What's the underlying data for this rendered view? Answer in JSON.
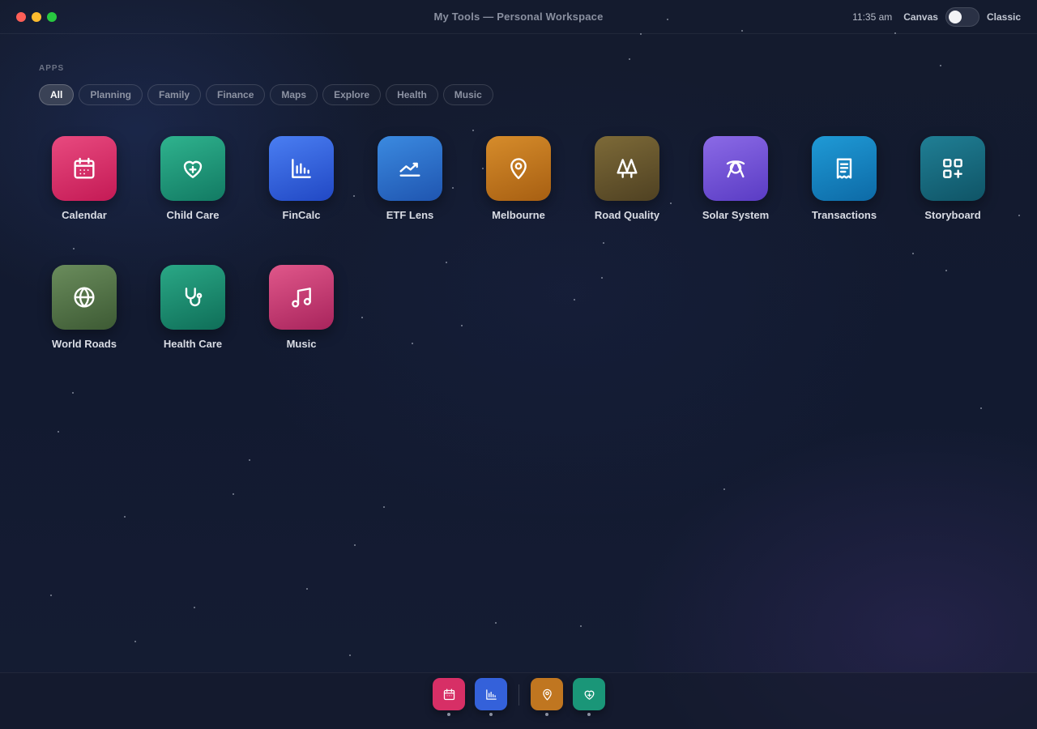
{
  "window": {
    "title": "My Tools — Personal Workspace"
  },
  "status": {
    "time": "11:35 am",
    "mode_left": "Canvas",
    "mode_right": "Classic"
  },
  "section": {
    "label": "APPS"
  },
  "filters": [
    "All",
    "Planning",
    "Family",
    "Finance",
    "Maps",
    "Explore",
    "Health",
    "Music"
  ],
  "active_filter": "All",
  "apps": [
    {
      "label": "Calendar",
      "icon": "calendar-icon",
      "color_top": "#e84a7f",
      "color_bottom": "#c41a55"
    },
    {
      "label": "Child Care",
      "icon": "heart-plus-icon",
      "color_top": "#2fb38e",
      "color_bottom": "#127a63"
    },
    {
      "label": "FinCalc",
      "icon": "bar-chart-icon",
      "color_top": "#4a7ef2",
      "color_bottom": "#2148c4"
    },
    {
      "label": "ETF Lens",
      "icon": "trend-line-icon",
      "color_top": "#3b8ae0",
      "color_bottom": "#1f55b0"
    },
    {
      "label": "Melbourne",
      "icon": "map-pin-icon",
      "color_top": "#d68c2b",
      "color_bottom": "#a75f12"
    },
    {
      "label": "Road Quality",
      "icon": "trees-icon",
      "color_top": "#7d6a38",
      "color_bottom": "#4f4122"
    },
    {
      "label": "Solar System",
      "icon": "orbit-icon",
      "color_top": "#8b6ae6",
      "color_bottom": "#5a3cc4"
    },
    {
      "label": "Transactions",
      "icon": "receipt-icon",
      "color_top": "#1f9ad6",
      "color_bottom": "#0d6aa6"
    },
    {
      "label": "Storyboard",
      "icon": "grid-plus-icon",
      "color_top": "#207f95",
      "color_bottom": "#0f5466"
    },
    {
      "label": "World Roads",
      "icon": "globe-icon",
      "color_top": "#6a8c5c",
      "color_bottom": "#3d5a34"
    },
    {
      "label": "Health Care",
      "icon": "stethoscope-icon",
      "color_top": "#2aa886",
      "color_bottom": "#0f6e58"
    },
    {
      "label": "Music",
      "icon": "music-note-icon",
      "color_top": "#e0578a",
      "color_bottom": "#a8245c"
    }
  ],
  "dock": [
    {
      "app": "Calendar",
      "icon": "calendar-icon",
      "color": "#d72f66"
    },
    {
      "app": "FinCalc",
      "icon": "bar-chart-icon",
      "color": "#3461da"
    },
    {
      "app": "Melbourne",
      "icon": "map-pin-icon",
      "color": "#c07620"
    },
    {
      "app": "Child Care",
      "icon": "heart-plus-icon",
      "color": "#1a9678"
    }
  ]
}
